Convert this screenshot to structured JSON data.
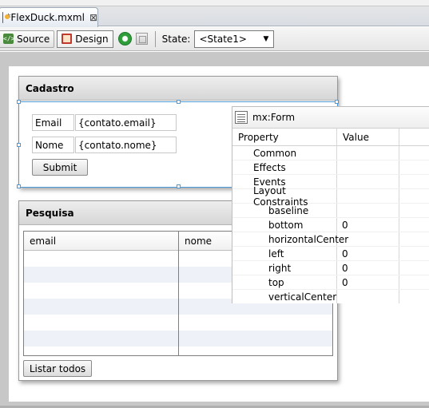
{
  "editor_tab": {
    "title": "*FlexDuck.mxml",
    "close": "⊠"
  },
  "toolbar": {
    "source_label": "Source",
    "design_label": "Design",
    "state_label": "State:",
    "state_value": "<State1>"
  },
  "cadastro": {
    "title": "Cadastro",
    "email_label": "Email",
    "email_value": "{contato.email}",
    "nome_label": "Nome",
    "nome_value": "{contato.nome}",
    "submit_label": "Submit"
  },
  "pesquisa": {
    "title": "Pesquisa",
    "columns": [
      "email",
      "nome"
    ],
    "list_button": "Listar todos"
  },
  "inspector": {
    "title": "mx:Form",
    "col_property": "Property",
    "col_value": "Value",
    "rows": [
      {
        "name": "Common",
        "value": ""
      },
      {
        "name": "Effects",
        "value": ""
      },
      {
        "name": "Events",
        "value": ""
      },
      {
        "name": "Layout Constraints",
        "value": ""
      },
      {
        "name": "baseline",
        "value": ""
      },
      {
        "name": "bottom",
        "value": "0"
      },
      {
        "name": "horizontalCenter",
        "value": ""
      },
      {
        "name": "left",
        "value": "0"
      },
      {
        "name": "right",
        "value": "0"
      },
      {
        "name": "top",
        "value": "0"
      },
      {
        "name": "verticalCenter",
        "value": ""
      }
    ]
  }
}
